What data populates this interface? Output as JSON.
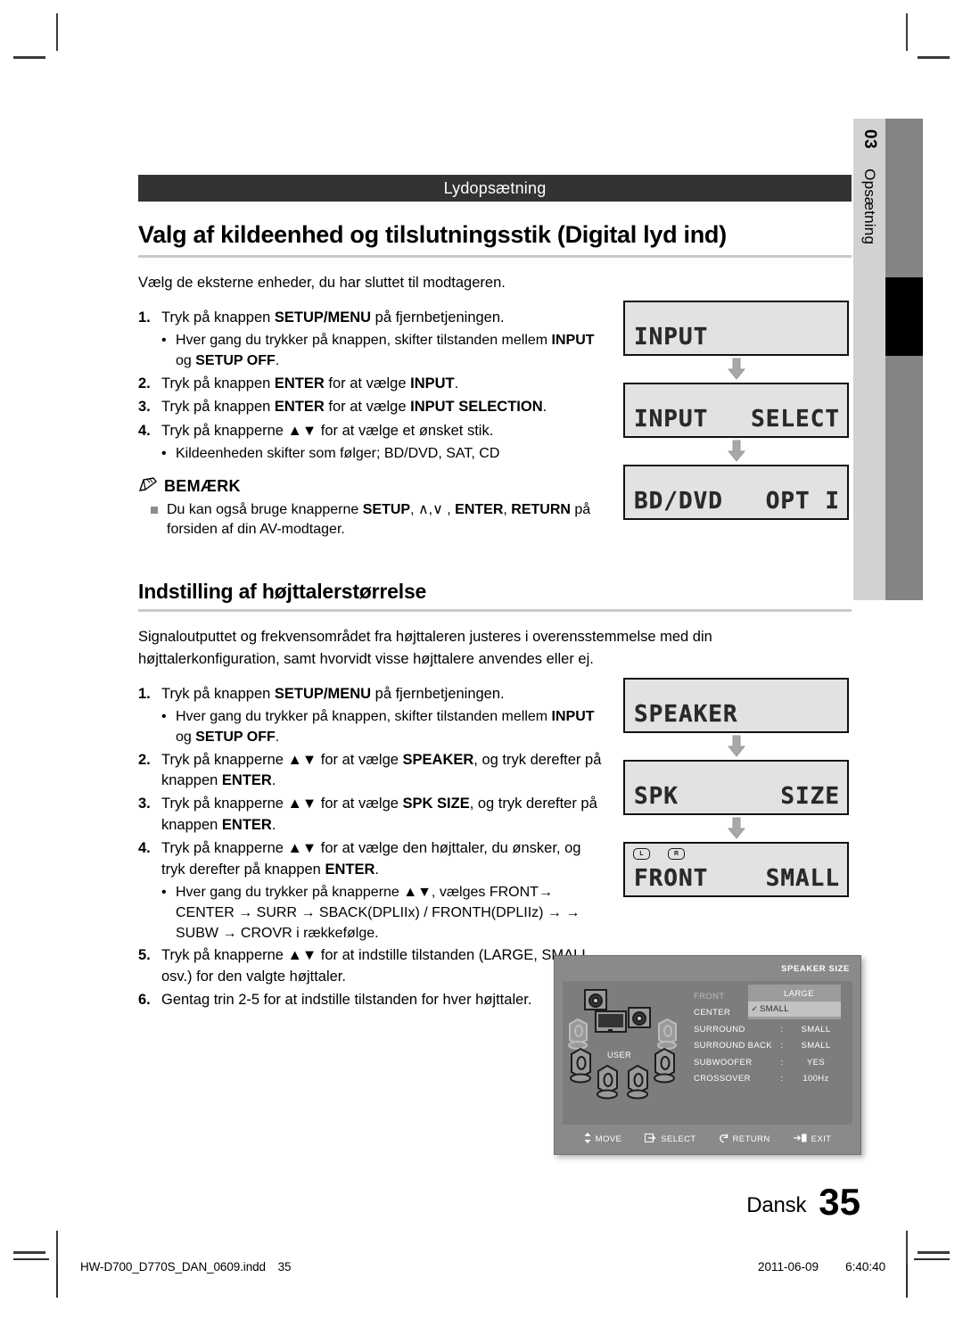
{
  "side_tab": {
    "number": "03",
    "label": "Opsætning"
  },
  "section_banner": "Lydopsætning",
  "section1": {
    "heading": "Valg af kildeenhed og tilslutningsstik (Digital lyd ind)",
    "intro": "Vælg de eksterne enheder, du har sluttet til modtageren.",
    "steps": [
      {
        "num": "1.",
        "html": "Tryk på knappen <b>SETUP/MENU</b> på fjernbetjeningen.",
        "subs": [
          "Hver gang du trykker på knappen, skifter tilstanden mellem <b>INPUT</b> og <b>SETUP OFF</b>."
        ]
      },
      {
        "num": "2.",
        "html": "Tryk på knappen <b>ENTER</b> for at vælge <b>INPUT</b>.",
        "subs": []
      },
      {
        "num": "3.",
        "html": "Tryk på knappen <b>ENTER</b> for at vælge <b>INPUT SELECTION</b>.",
        "subs": []
      },
      {
        "num": "4.",
        "html": "Tryk på knapperne ▲▼ for at vælge et ønsket stik.",
        "subs": [
          "Kildeenheden skifter som følger; BD/DVD, SAT, CD"
        ]
      }
    ],
    "note": {
      "title": "BEMÆRK",
      "items": [
        "Du kan også bruge knapperne <b>SETUP</b>, ∧,∨ , <b>ENTER</b>, <b>RETURN</b> på forsiden af din AV-modtager."
      ]
    },
    "lcd": [
      {
        "text": "INPUT",
        "align": "left",
        "indicators": []
      },
      {
        "left": "INPUT",
        "right": "SELECT",
        "align": "spread",
        "indicators": []
      },
      {
        "left": "BD/DVD",
        "right": "OPT I",
        "align": "spread",
        "indicators": []
      }
    ]
  },
  "section2": {
    "heading": "Indstilling af højttalerstørrelse",
    "intro": "Signaloutputtet og frekvensområdet fra højttaleren justeres i overensstemmelse med din højttalerkonfiguration, samt hvorvidt visse højttalere anvendes eller ej.",
    "steps": [
      {
        "num": "1.",
        "html": "Tryk på knappen <b>SETUP/MENU</b> på fjernbetjeningen.",
        "subs": [
          "Hver gang du trykker på knappen, skifter tilstanden mellem <b>INPUT</b> og <b>SETUP OFF</b>."
        ]
      },
      {
        "num": "2.",
        "html": "Tryk på knapperne ▲▼ for at vælge <b>SPEAKER</b>, og tryk derefter på knappen <b>ENTER</b>.",
        "subs": []
      },
      {
        "num": "3.",
        "html": "Tryk på knapperne ▲▼ for at vælge <b>SPK SIZE</b>, og tryk derefter på knappen <b>ENTER</b>.",
        "subs": []
      },
      {
        "num": "4.",
        "html": "Tryk på knapperne ▲▼ for at vælge den højttaler, du ønsker, og tryk derefter på knappen <b>ENTER</b>.",
        "subs": [
          "Hver gang du trykker på knapperne ▲▼, vælges FRONT&#8594; CENTER &#8594; SURR &#8594; SBACK(DPLIIx) / FRONTH(DPLIIz) &#8594; &#8594; SUBW &#8594; CROVR i rækkefølge."
        ]
      },
      {
        "num": "5.",
        "html": "Tryk på knapperne ▲▼ for at indstille tilstanden (LARGE, SMALL osv.) for den valgte højttaler.",
        "subs": []
      },
      {
        "num": "6.",
        "html": "Gentag trin 2-5 for at indstille tilstanden for hver højttaler.",
        "subs": []
      }
    ],
    "lcd": [
      {
        "text": "SPEAKER",
        "align": "left",
        "indicators": []
      },
      {
        "left": "SPK",
        "right": "SIZE",
        "align": "spread",
        "indicators": []
      },
      {
        "left": "FRONT",
        "right": "SMALL",
        "align": "spread",
        "indicators": [
          "L",
          "R"
        ]
      }
    ]
  },
  "osd": {
    "title": "SPEAKER SIZE",
    "user_label": "USER",
    "rows": [
      {
        "name": "FRONT",
        "colon": "",
        "value": "",
        "dim": true
      },
      {
        "name": "CENTER",
        "colon": "",
        "value": "",
        "dim": false
      },
      {
        "name": "SURROUND",
        "colon": ":",
        "value": "SMALL",
        "dim": false
      },
      {
        "name": "SURROUND BACK",
        "colon": ":",
        "value": "SMALL",
        "dim": false
      },
      {
        "name": "SUBWOOFER",
        "colon": ":",
        "value": "YES",
        "dim": false
      },
      {
        "name": "CROSSOVER",
        "colon": ":",
        "value": "100Hz",
        "dim": false
      }
    ],
    "dropdown": {
      "options": [
        {
          "label": "LARGE",
          "selected": false,
          "check": ""
        },
        {
          "label": "SMALL",
          "selected": true,
          "check": "✓"
        }
      ]
    },
    "footer": [
      {
        "icon": "updown-arrow-icon",
        "label": "MOVE"
      },
      {
        "icon": "select-enter-icon",
        "label": "SELECT"
      },
      {
        "icon": "return-icon",
        "label": "RETURN"
      },
      {
        "icon": "exit-icon",
        "label": "EXIT"
      }
    ]
  },
  "page_footer": {
    "language": "Dansk",
    "page_number": "35",
    "file_name": "HW-D700_D770S_DAN_0609.indd",
    "file_page": "35",
    "date": "2011-06-09",
    "time": "6:40:40"
  }
}
